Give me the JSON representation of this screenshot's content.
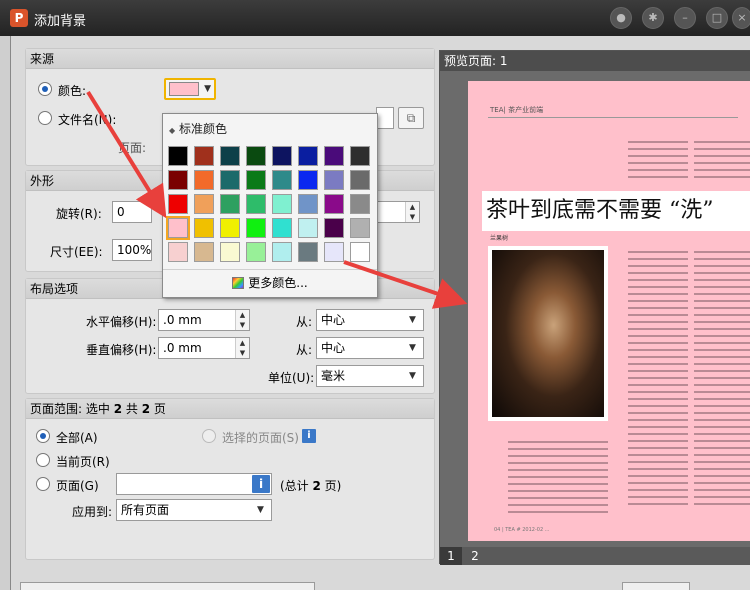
{
  "window": {
    "title": "添加背景",
    "app_icon": "P",
    "titlebar_icons": [
      "user-icon",
      "settings-icon",
      "minimize-icon",
      "maximize-icon",
      "close-icon"
    ]
  },
  "source": {
    "header": "来源",
    "color_label": "颜色:",
    "file_label": "文件名(N):",
    "page_label": "页面:",
    "selected_color": "#ffc0cb"
  },
  "appearance": {
    "header": "外形",
    "rotate_label": "旋转(R):",
    "rotate_value": "0",
    "size_label": "尺寸(EE):",
    "size_value": "100%"
  },
  "layout": {
    "header": "布局选项",
    "h_offset_label": "水平偏移(H):",
    "h_offset_value": ".0 mm",
    "v_offset_label": "垂直偏移(H):",
    "v_offset_value": ".0 mm",
    "from_label_1": "从:",
    "from_value_1": "中心",
    "from_label_2": "从:",
    "from_value_2": "中心",
    "unit_label": "单位(U):",
    "unit_value": "毫米"
  },
  "page_range": {
    "header_prefix": "页面范围: 选中 ",
    "header_selected": "2",
    "header_mid": " 共 ",
    "header_total": "2",
    "header_suffix": " 页",
    "all_label": "全部(A)",
    "selected_pages_label": "选择的页面(S)",
    "current_label": "当前页(R)",
    "pages_label": "页面(G)",
    "pages_value": "",
    "total_prefix": "(总计 ",
    "total_value": "2",
    "total_suffix": " 页)",
    "apply_label": "应用到:",
    "apply_value": "所有页面"
  },
  "color_popup": {
    "header": "标准颜色",
    "more_colors": "更多颜色...",
    "selected": "#ffc0cb",
    "colors": [
      [
        "#000000",
        "#a0301c",
        "#0d4049",
        "#0a4a10",
        "#0d1460",
        "#0a1ea0",
        "#4a0b7a",
        "#2e2e2e"
      ],
      [
        "#7a0000",
        "#f26a2a",
        "#1b6a6a",
        "#0a7a18",
        "#2e8a8a",
        "#0a28f0",
        "#7b7bc2",
        "#6a6a6a"
      ],
      [
        "#ee0000",
        "#f0a05a",
        "#2ea060",
        "#2ebc6a",
        "#7ff0d0",
        "#7094c8",
        "#8a0a8a",
        "#8a8a8a"
      ],
      [
        "#ffc0cb",
        "#f0c000",
        "#f0f000",
        "#10f010",
        "#30e0d0",
        "#c0f0f0",
        "#4a004a",
        "#b0b0b0"
      ],
      [
        "#f7d0d0",
        "#d7b890",
        "#fafad2",
        "#98f098",
        "#b0eeee",
        "#6a7a80",
        "#e6e6fa",
        "#ffffff"
      ]
    ]
  },
  "preview": {
    "header": "预览页面: 1",
    "tabs": [
      "1",
      "2"
    ],
    "page_header_text": "TEA| 茶产业前端",
    "title": "茶叶到底需不需要 “洗”",
    "author": "兰果树",
    "footer": "04 | TEA  # 2012-02 ..."
  },
  "colors": {
    "accent_blue": "#1f5fb8",
    "arrow_red": "#e8403c",
    "page_pink": "#ffc0cb"
  }
}
